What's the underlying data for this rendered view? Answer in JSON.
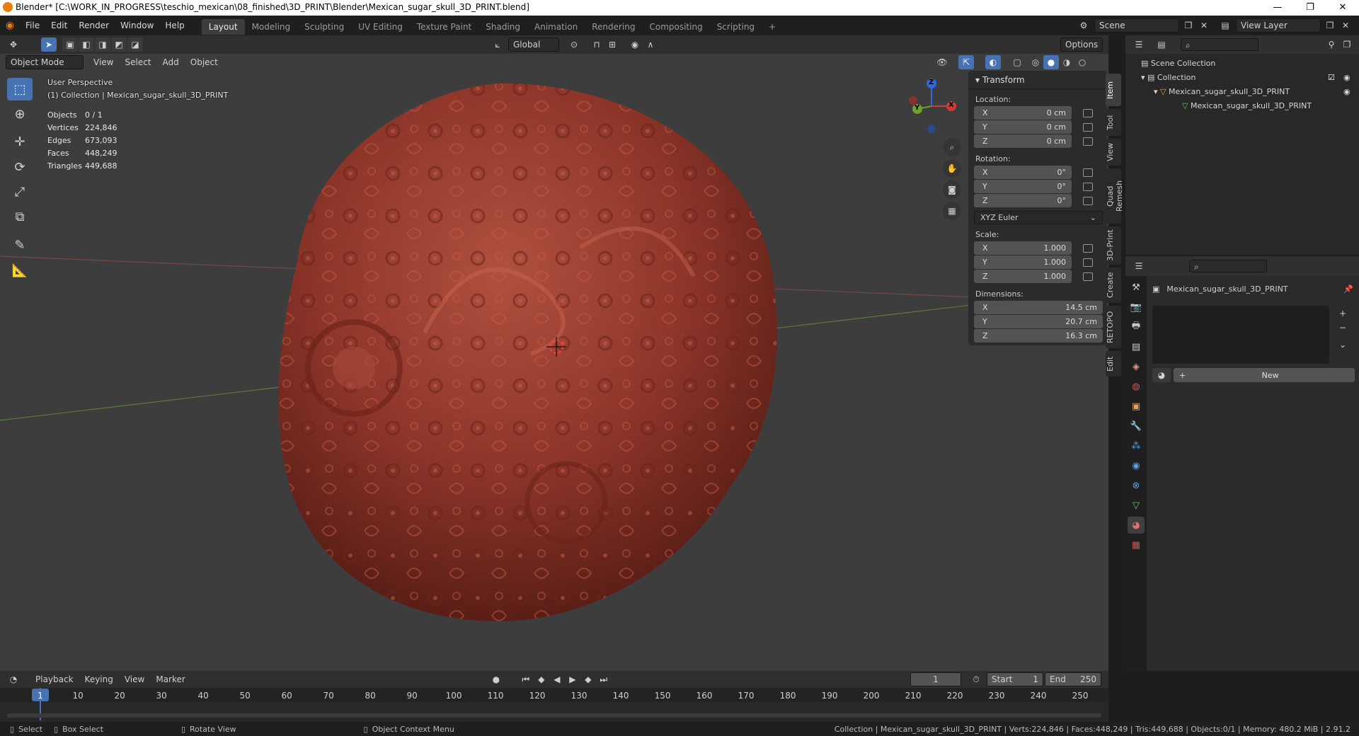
{
  "window": {
    "title": "Blender* [C:\\WORK_IN_PROGRESS\\teschio_mexican\\08_finished\\3D_PRINT\\Blender\\Mexican_sugar_skull_3D_PRINT.blend]",
    "min": "—",
    "max": "❐",
    "close": "✕"
  },
  "menu": {
    "items": [
      "File",
      "Edit",
      "Render",
      "Window",
      "Help"
    ]
  },
  "workspaces": [
    "Layout",
    "Modeling",
    "Sculpting",
    "UV Editing",
    "Texture Paint",
    "Shading",
    "Animation",
    "Rendering",
    "Compositing",
    "Scripting"
  ],
  "workspace_add": "+",
  "scene": {
    "name": "Scene",
    "view_layer": "View Layer"
  },
  "viewport_header": {
    "orientation": "Global",
    "options": "Options",
    "mode": "Object Mode",
    "menus": [
      "View",
      "Select",
      "Add",
      "Object"
    ]
  },
  "overlay": {
    "perspective": "User Perspective",
    "collection": "(1) Collection | Mexican_sugar_skull_3D_PRINT",
    "stats": [
      {
        "k": "Objects",
        "v": "0 / 1"
      },
      {
        "k": "Vertices",
        "v": "224,846"
      },
      {
        "k": "Edges",
        "v": "673,093"
      },
      {
        "k": "Faces",
        "v": "448,249"
      },
      {
        "k": "Triangles",
        "v": "449,688"
      }
    ]
  },
  "gizmo": {
    "x": "X",
    "y": "Y",
    "z": "Z"
  },
  "npanel": {
    "header": "Transform",
    "location_label": "Location:",
    "location": [
      {
        "axis": "X",
        "v": "0 cm"
      },
      {
        "axis": "Y",
        "v": "0 cm"
      },
      {
        "axis": "Z",
        "v": "0 cm"
      }
    ],
    "rotation_label": "Rotation:",
    "rotation": [
      {
        "axis": "X",
        "v": "0°"
      },
      {
        "axis": "Y",
        "v": "0°"
      },
      {
        "axis": "Z",
        "v": "0°"
      }
    ],
    "rotation_mode": "XYZ Euler",
    "scale_label": "Scale:",
    "scale": [
      {
        "axis": "X",
        "v": "1.000"
      },
      {
        "axis": "Y",
        "v": "1.000"
      },
      {
        "axis": "Z",
        "v": "1.000"
      }
    ],
    "dimensions_label": "Dimensions:",
    "dimensions": [
      {
        "axis": "X",
        "v": "14.5 cm"
      },
      {
        "axis": "Y",
        "v": "20.7 cm"
      },
      {
        "axis": "Z",
        "v": "16.3 cm"
      }
    ],
    "tabs": [
      "Item",
      "Tool",
      "View",
      "Quad Remesh",
      "3D-Print",
      "Create",
      "RETOPO",
      "Edit"
    ]
  },
  "outliner": {
    "root": "Scene Collection",
    "collection": "Collection",
    "object": "Mexican_sugar_skull_3D_PRINT",
    "mesh": "Mexican_sugar_skull_3D_PRINT"
  },
  "properties": {
    "object_name": "Mexican_sugar_skull_3D_PRINT",
    "new_button": "New"
  },
  "timeline": {
    "menus": [
      "Playback",
      "Keying",
      "View",
      "Marker"
    ],
    "current_frame": "1",
    "start_label": "Start",
    "start": "1",
    "end_label": "End",
    "end": "250",
    "ticks": [
      "1",
      "10",
      "20",
      "30",
      "40",
      "50",
      "60",
      "70",
      "80",
      "90",
      "100",
      "110",
      "120",
      "130",
      "140",
      "150",
      "160",
      "170",
      "180",
      "190",
      "200",
      "210",
      "220",
      "230",
      "240",
      "250"
    ]
  },
  "statusbar": {
    "select": "Select",
    "box_select": "Box Select",
    "rotate": "Rotate View",
    "context": "Object Context Menu",
    "info": "Collection | Mexican_sugar_skull_3D_PRINT | Verts:224,846 | Faces:448,249 | Tris:449,688 | Objects:0/1 | Memory: 480.2 MiB | 2.91.2"
  },
  "colors": {
    "accent": "#4772b3",
    "viewport": "#3d3d3d",
    "mesh": "#9a3b2e"
  }
}
